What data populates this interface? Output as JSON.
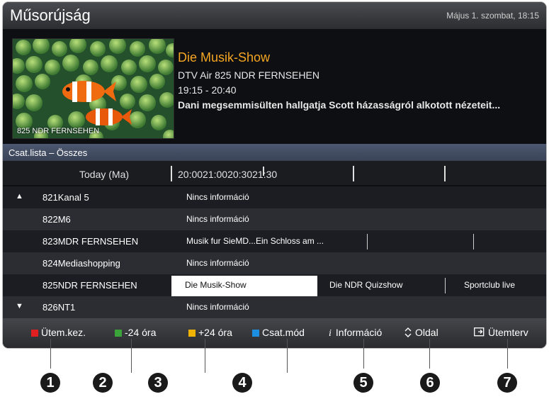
{
  "header": {
    "title": "Műsorújság",
    "datetime": "Május 1. szombat, 18:15"
  },
  "preview": {
    "channel_label": "825 NDR FERNSEHEN"
  },
  "program": {
    "title": "Die Musik-Show",
    "channel": "DTV Air 825 NDR FERNSEHEN",
    "time": "19:15 - 20:40",
    "description": "Dani megsemmisülten hallgatja Scott házasságról alkotott nézeteit..."
  },
  "list_header": "Csat.lista – Összes",
  "timeline": {
    "day": "Today (Ma)",
    "times": "20:0021:0020:3021:30"
  },
  "channels": [
    {
      "arrow": "▲",
      "name": "821Kanal 5",
      "programs": [
        "Nincs információ"
      ]
    },
    {
      "arrow": "",
      "name": "822M6",
      "programs": [
        "Nincs információ"
      ]
    },
    {
      "arrow": "",
      "name": "823MDR FERNSEHEN",
      "programs": [
        "Musik fur SieMD...Ein Schloss am ..."
      ]
    },
    {
      "arrow": "",
      "name": "824Mediashopping",
      "programs": [
        "Nincs információ"
      ]
    },
    {
      "arrow": "",
      "name": "825NDR FERNSEHEN",
      "programs": [
        "Die Musik-Show",
        "Die NDR Quizshow",
        "Sportclub live"
      ]
    },
    {
      "arrow": "▼",
      "name": "826NT1",
      "programs": [
        "Nincs információ"
      ]
    }
  ],
  "legend": {
    "red": "Ütem.kez.",
    "green": "-24 óra",
    "yellow": "+24 óra",
    "blue": "Csat.mód",
    "info_icon": "i",
    "info": "Információ",
    "page": "Oldal",
    "schedule": "Ütemterv"
  },
  "colors": {
    "red": "#e02020",
    "green": "#3aa33a",
    "yellow": "#f0b400",
    "blue": "#1d8fe0",
    "accent": "#f5a623"
  },
  "callouts": [
    "1",
    "2",
    "3",
    "4",
    "5",
    "6",
    "7"
  ]
}
